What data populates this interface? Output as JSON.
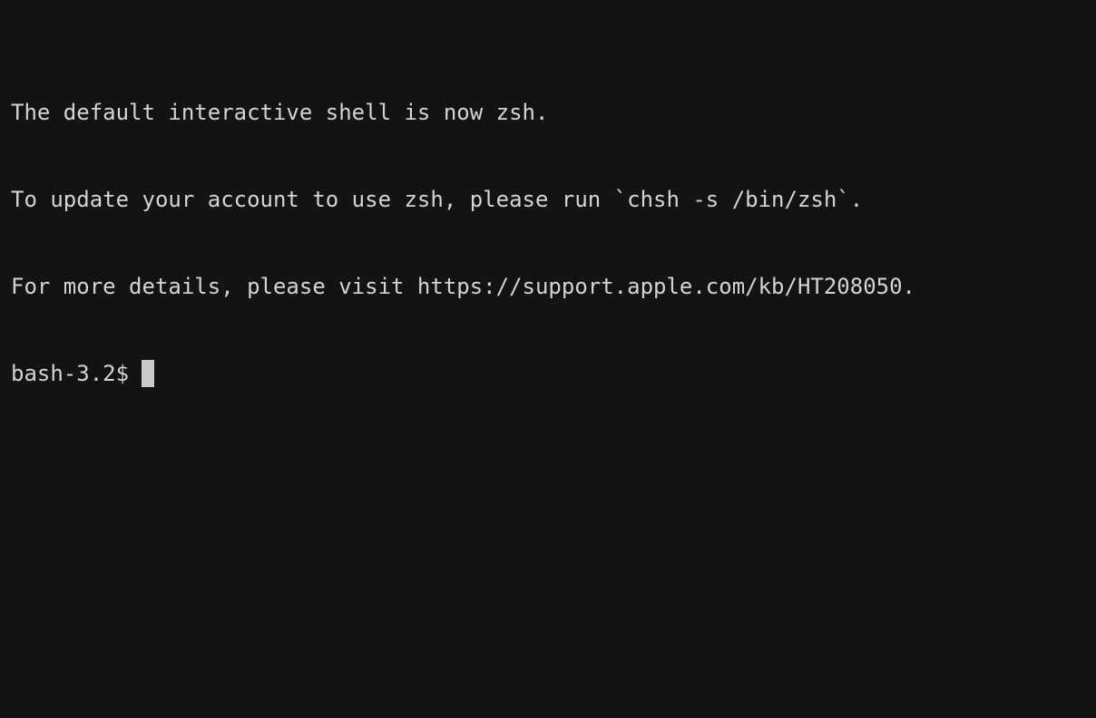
{
  "terminal": {
    "lines": [
      "The default interactive shell is now zsh.",
      "To update your account to use zsh, please run `chsh -s /bin/zsh`.",
      "For more details, please visit https://support.apple.com/kb/HT208050."
    ],
    "prompt": "bash-3.2$",
    "input": ""
  },
  "colors": {
    "background": "#121315",
    "text": "#d3d4d5",
    "cursor": "#c9cacb"
  }
}
